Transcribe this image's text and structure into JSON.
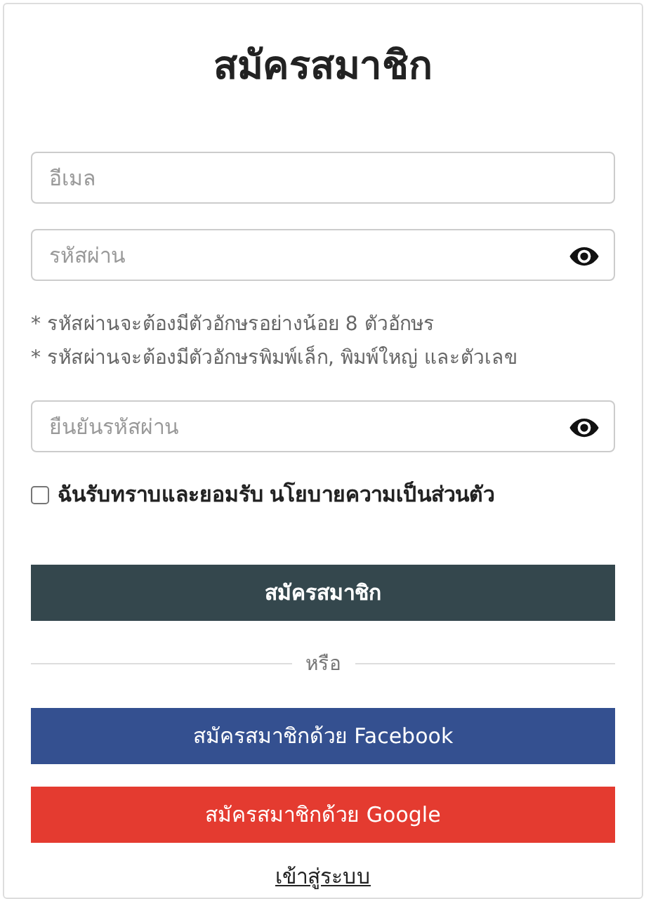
{
  "title": "สมัครสมาชิก",
  "fields": [
    {
      "placeholder": "อีเมล",
      "kind": "text"
    },
    {
      "placeholder": "รหัสผ่าน",
      "kind": "password"
    }
  ],
  "hints": [
    "* รหัสผ่านจะต้องมีตัวอักษรอย่างน้อย 8 ตัวอักษร",
    "* รหัสผ่านจะต้องมีตัวอักษรพิมพ์เล็ก, พิมพ์ใหญ่ และตัวเลข"
  ],
  "confirm_field": {
    "placeholder": "ยืนยันรหัสผ่าน",
    "kind": "password"
  },
  "consent": {
    "checked": false,
    "label": "ฉันรับทราบและยอมรับ",
    "link": "นโยบายความเป็นส่วนตัว"
  },
  "submit": {
    "label": "สมัครสมาชิก",
    "kind": "primary"
  },
  "divider": "หรือ",
  "social_buttons": [
    {
      "label": "สมัครสมาชิกด้วย Facebook",
      "kind": "facebook"
    },
    {
      "label": "สมัครสมาชิกด้วย Google",
      "kind": "google"
    }
  ],
  "login_link": "เข้าสู่ระบบ"
}
